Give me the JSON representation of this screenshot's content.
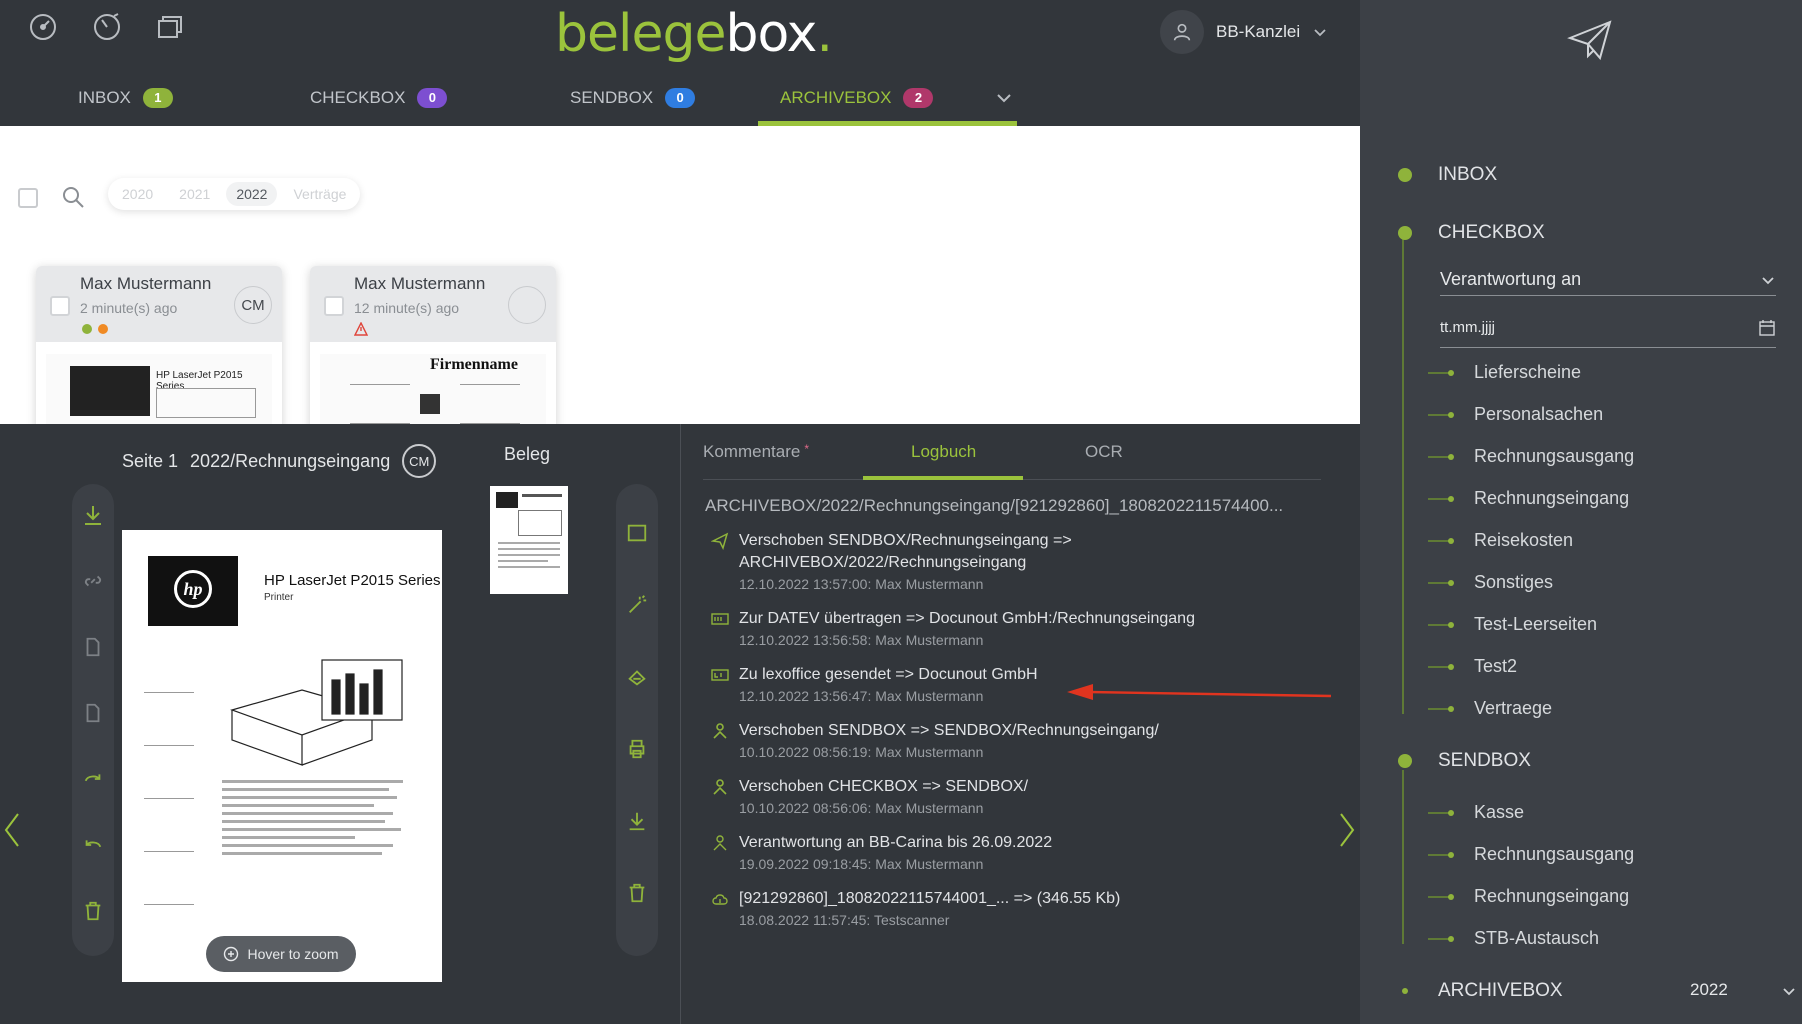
{
  "app": {
    "logo_left": "belege",
    "logo_right": "box",
    "logo_dot": ".",
    "user_name": "BB-Kanzlei"
  },
  "tabs": [
    {
      "label": "INBOX",
      "count": "1",
      "color": "#8fb33b"
    },
    {
      "label": "CHECKBOX",
      "count": "0",
      "color": "#7d4fd1"
    },
    {
      "label": "SENDBOX",
      "count": "0",
      "color": "#2f7de1"
    },
    {
      "label": "ARCHIVEBOX",
      "count": "2",
      "color": "#b0386a"
    }
  ],
  "filters": {
    "years": [
      "2020",
      "2021",
      "2022",
      "Verträge"
    ],
    "active": "2022"
  },
  "cards": [
    {
      "name": "Max Mustermann",
      "time": "2 minute(s) ago",
      "initials": "CM"
    },
    {
      "name": "Max Mustermann",
      "time": "12 minute(s) ago",
      "initials": ""
    }
  ],
  "viewer": {
    "page": "Seite 1",
    "path": "2022/Rechnungseingang",
    "initials": "CM",
    "beleg": "Beleg",
    "zoom_label": "Hover to zoom",
    "doc_title": "HP LaserJet P2015 Series",
    "doc_sub": "Printer",
    "card2_title": "Firmenname"
  },
  "log": {
    "tabs": [
      "Kommentare",
      "Logbuch",
      "OCR"
    ],
    "comment_marker": "*",
    "active_tab": "Logbuch",
    "path": "ARCHIVEBOX/2022/Rechnungseingang/[921292860]_1808202211574400...",
    "entries": [
      {
        "icon": "rocket-icon",
        "text": "Verschoben SENDBOX/Rechnungseingang => ARCHIVEBOX/2022/Rechnungseingang",
        "meta": "12.10.2022 13:57:00: Max Mustermann"
      },
      {
        "icon": "datev-icon",
        "text": "Zur DATEV übertragen => Docunout GmbH:/Rechnungseingang",
        "meta": "12.10.2022 13:56:58: Max Mustermann"
      },
      {
        "icon": "lexoffice-icon",
        "text": "Zu lexoffice gesendet => Docunout GmbH",
        "meta": "12.10.2022 13:56:47: Max Mustermann"
      },
      {
        "icon": "move-icon",
        "text": "Verschoben SENDBOX => SENDBOX/Rechnungseingang/",
        "meta": "10.10.2022 08:56:19: Max Mustermann"
      },
      {
        "icon": "move-icon",
        "text": "Verschoben CHECKBOX => SENDBOX/",
        "meta": "10.10.2022 08:56:06: Max Mustermann"
      },
      {
        "icon": "responsibility-icon",
        "text": "Verantwortung an BB-Carina bis 26.09.2022",
        "meta": "19.09.2022 09:18:45: Max Mustermann"
      },
      {
        "icon": "upload-cloud-icon",
        "text": "[921292860]_18082022115744001_... => (346.55 Kb)",
        "meta": "18.08.2022 11:57:45: Testscanner"
      }
    ]
  },
  "sidebar": {
    "sections": [
      {
        "label": "INBOX",
        "items": []
      },
      {
        "label": "CHECKBOX",
        "items": [
          "Lieferscheine",
          "Personalsachen",
          "Rechnungsausgang",
          "Rechnungseingang",
          "Reisekosten",
          "Sonstiges",
          "Test-Leerseiten",
          "Test2",
          "Vertraege"
        ]
      },
      {
        "label": "SENDBOX",
        "items": [
          "Kasse",
          "Rechnungsausgang",
          "Rechnungseingang",
          "STB-Austausch"
        ]
      },
      {
        "label": "ARCHIVEBOX",
        "items": []
      }
    ],
    "responsibility_select": "Verantwortung an",
    "date_placeholder": "tt.mm.jjjj",
    "archive_year": "2022"
  }
}
